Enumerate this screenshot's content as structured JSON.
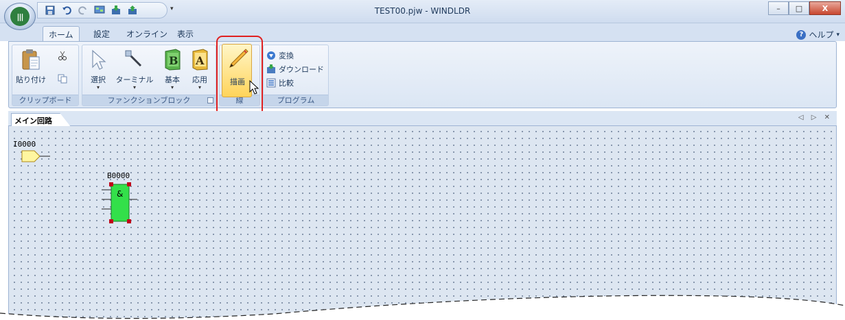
{
  "window": {
    "title": "TEST00.pjw - WINDLDR",
    "minimize_glyph": "–",
    "maximize_glyph": "□",
    "close_glyph": "X"
  },
  "quick_access": {
    "icons": [
      "save-icon",
      "undo-icon",
      "redo-icon",
      "monitor-icon",
      "download-icon",
      "upload-icon"
    ],
    "dropdown_glyph": "▾"
  },
  "tabs": [
    {
      "label": "ホーム",
      "active": true
    },
    {
      "label": "設定",
      "active": false
    },
    {
      "label": "オンライン",
      "active": false
    },
    {
      "label": "表示",
      "active": false
    }
  ],
  "help": {
    "label": "ヘルプ",
    "icon_glyph": "?",
    "caret": "▾"
  },
  "ribbon": {
    "clipboard": {
      "label": "クリップボード",
      "paste": "貼り付け"
    },
    "function_block": {
      "label": "ファンクションブロック",
      "select": "選択",
      "terminal": "ターミナル",
      "basic": "基本",
      "application": "応用",
      "basic_glyph": "B",
      "application_glyph": "A",
      "caret": "▾"
    },
    "line": {
      "label": "線",
      "draw": "描画"
    },
    "program": {
      "label": "プログラム",
      "convert": "変換",
      "download": "ダウンロード",
      "compare": "比較"
    }
  },
  "document": {
    "tab_label": "メイン回路",
    "nav_glyphs": "◁ ▷ ✕"
  },
  "canvas": {
    "input_block": {
      "label": "I0000"
    },
    "and_block": {
      "label": "B0000",
      "symbol": "&"
    }
  },
  "colors": {
    "canvas_bg": "#dde6f1",
    "input_fill": "#fff6a0",
    "and_fill": "#33e04a",
    "handle": "#c0001a",
    "highlight": "#e02020"
  }
}
